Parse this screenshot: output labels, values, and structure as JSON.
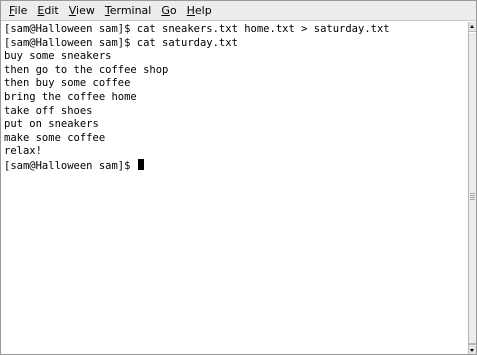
{
  "menu": [
    {
      "mnemonic": "F",
      "rest": "ile"
    },
    {
      "mnemonic": "E",
      "rest": "dit"
    },
    {
      "mnemonic": "V",
      "rest": "iew"
    },
    {
      "mnemonic": "T",
      "rest": "erminal"
    },
    {
      "mnemonic": "G",
      "rest": "o"
    },
    {
      "mnemonic": "H",
      "rest": "elp"
    }
  ],
  "terminal": {
    "lines": [
      "[sam@Halloween sam]$ cat sneakers.txt home.txt > saturday.txt",
      "[sam@Halloween sam]$ cat saturday.txt",
      "buy some sneakers",
      "then go to the coffee shop",
      "then buy some coffee",
      "bring the coffee home",
      "take off shoes",
      "put on sneakers",
      "make some coffee",
      "relax!"
    ],
    "prompt": "[sam@Halloween sam]$ "
  },
  "icons": {
    "scroll_up": "arrow-up-icon",
    "scroll_down": "arrow-down-icon",
    "scroll_grip": "grip-icon"
  }
}
